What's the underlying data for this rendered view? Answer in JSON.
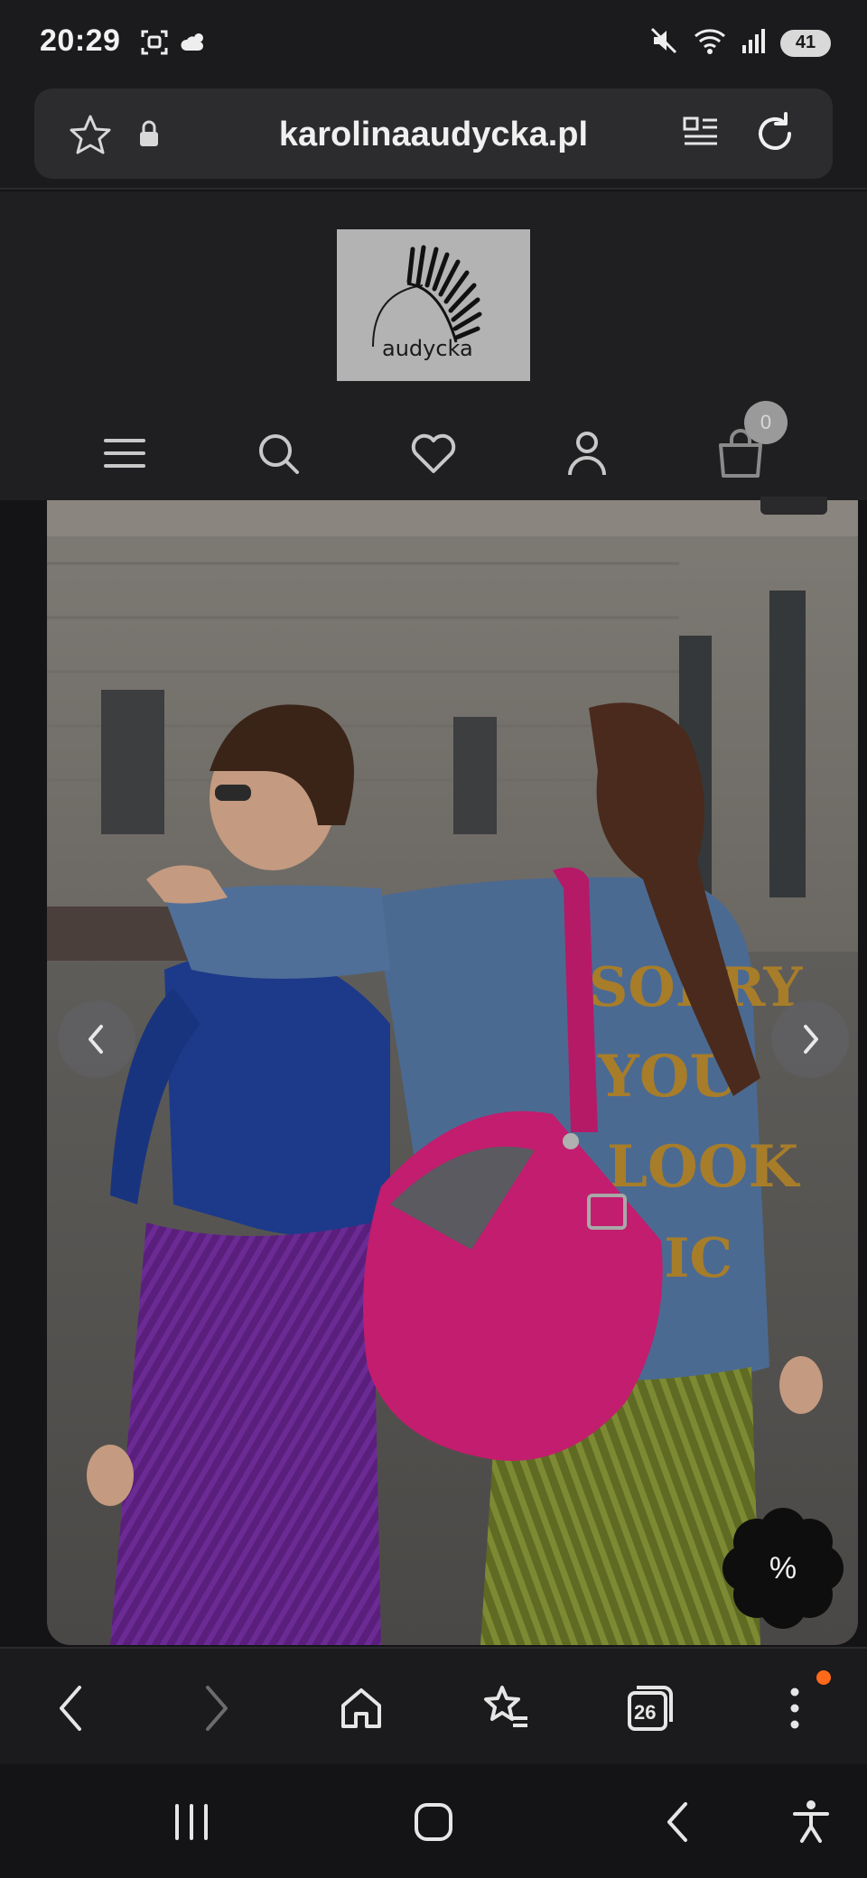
{
  "status_bar": {
    "time": "20:29",
    "battery": "41",
    "icons_left": [
      "screenshot-icon",
      "weather-icon"
    ],
    "icons_right": [
      "mute-icon",
      "wifi-icon",
      "signal-icon",
      "battery-icon"
    ]
  },
  "browser": {
    "url": "karolinaaudycka.pl",
    "tabs_count": "26"
  },
  "site": {
    "logo_text": "audycka",
    "cart_count": "0",
    "nav_icons": [
      "menu-icon",
      "search-icon",
      "heart-icon",
      "account-icon",
      "cart-icon"
    ]
  },
  "hero": {
    "promo_label": "%",
    "image_subject": "two women walking on a street, one carrying a pink suede bag"
  },
  "colors": {
    "background": "#141416",
    "toolbar": "#1b1b1d",
    "bag_pink": "#c2185b",
    "accent_dot": "#ff6a1a"
  }
}
